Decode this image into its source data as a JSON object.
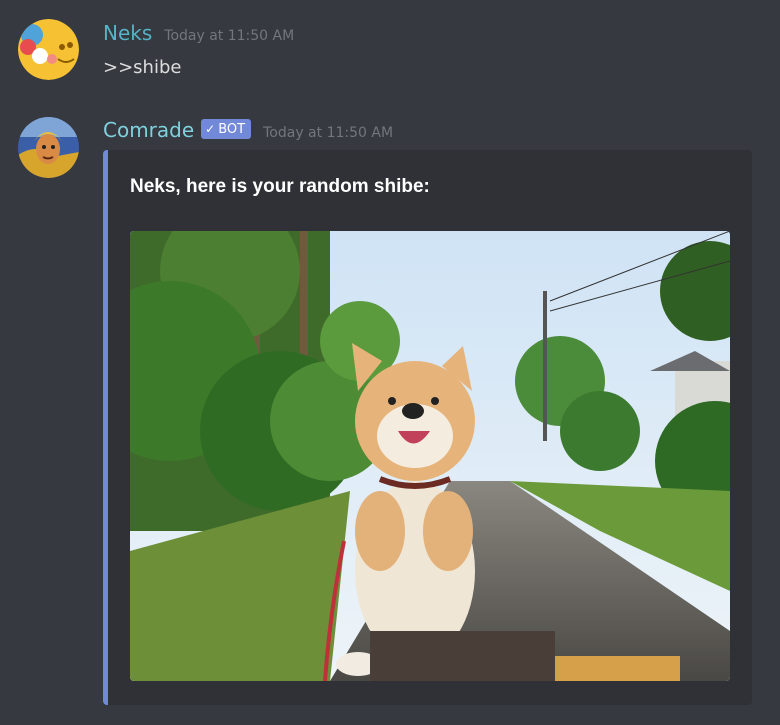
{
  "messages": [
    {
      "username": "Neks",
      "username_color": "#55b4c7",
      "timestamp": "Today at 11:50 AM",
      "content": ">>shibe"
    },
    {
      "username": "Comrade",
      "username_color": "#7fd1de",
      "bot_tag": {
        "check": "✓",
        "label": "BOT"
      },
      "timestamp": "Today at 11:50 AM",
      "embed": {
        "title": "Neks, here is your random shibe:",
        "border_color": "#7289da"
      }
    }
  ],
  "colors": {
    "background": "#36393f",
    "embed_background": "#2f3136",
    "accent": "#7289da"
  }
}
